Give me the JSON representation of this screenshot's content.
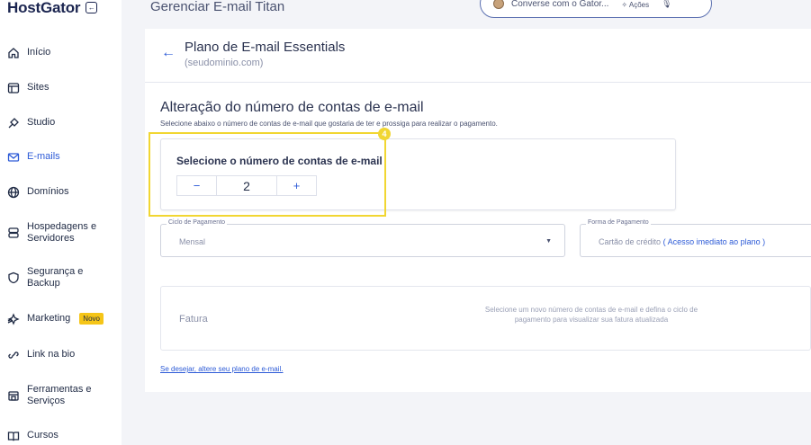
{
  "sidebar": {
    "logo": "HostGator",
    "items": [
      {
        "label": "Início",
        "icon": "home-icon"
      },
      {
        "label": "Sites",
        "icon": "browser-icon"
      },
      {
        "label": "Studio",
        "icon": "studio-icon"
      },
      {
        "label": "E-mails",
        "icon": "mail-icon",
        "active": true
      },
      {
        "label": "Domínios",
        "icon": "globe-icon"
      },
      {
        "label": "Hospedagens e",
        "label2": "Servidores",
        "icon": "server-icon"
      },
      {
        "label": "Segurança e",
        "label2": "Backup",
        "icon": "shield-icon"
      },
      {
        "label": "Marketing",
        "badge": "Novo",
        "icon": "marketing-icon"
      },
      {
        "label": "Link na bio",
        "icon": "link-icon"
      },
      {
        "label": "Ferramentas e",
        "label2": "Serviços",
        "icon": "tools-icon"
      },
      {
        "label": "Cursos",
        "icon": "book-icon"
      }
    ]
  },
  "topbar": {
    "title": "Gerenciar E-mail Titan",
    "chat_label": "Converse com o Gator...",
    "actions_label": "Ações"
  },
  "plan": {
    "title": "Plano de E-mail Essentials",
    "domain": "(seudominio.com)"
  },
  "section": {
    "title": "Alteração do número de contas de e-mail",
    "description": "Selecione abaixo o número de contas de e-mail que gostaria de ter e prossiga para realizar o pagamento."
  },
  "count": {
    "label": "Selecione o número de contas de e-mail",
    "minus": "−",
    "value": "2",
    "plus": "+",
    "step_marker": "4"
  },
  "billing": {
    "cycle_label": "Ciclo de Pagamento",
    "cycle_value": "Mensal",
    "method_label": "Forma de Pagamento",
    "method_value": "Cartão de crédito",
    "method_note": "( Acesso imediato ao plano )"
  },
  "invoice": {
    "title": "Fatura",
    "message": "Selecione um novo número de contas de e-mail e defina o ciclo de pagamento para visualizar sua fatura atualizada"
  },
  "change_plan_link": "Se desejar, altere seu plano de e-mail.",
  "colors": {
    "accent": "#2d5bd7",
    "highlight": "#f1d632",
    "badge": "#f5c518"
  }
}
